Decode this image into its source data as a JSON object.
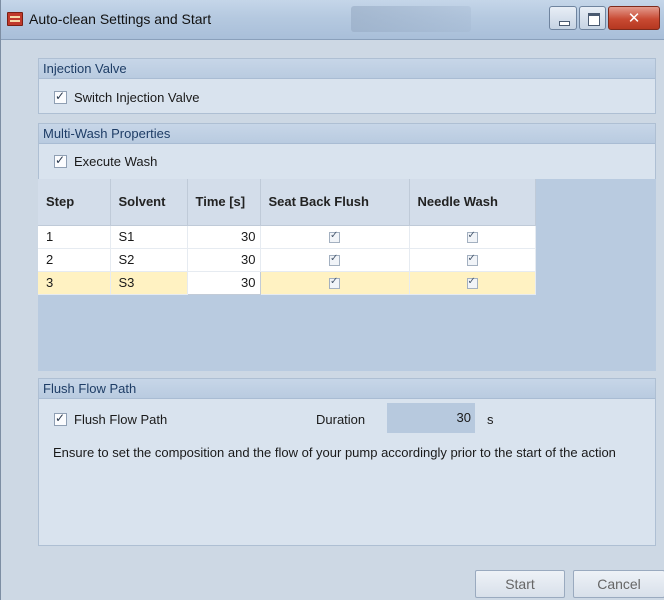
{
  "window": {
    "title": "Auto-clean Settings and Start"
  },
  "injection_valve": {
    "header": "Injection Valve",
    "switch_label": "Switch Injection Valve",
    "switch_checked": true
  },
  "multi_wash": {
    "header": "Multi-Wash Properties",
    "execute_label": "Execute Wash",
    "execute_checked": true,
    "columns": [
      "Step",
      "Solvent",
      "Time [s]",
      "Seat Back Flush",
      "Needle Wash"
    ],
    "rows": [
      {
        "step": "1",
        "solvent": "S1",
        "time": "30",
        "seat_back_flush": true,
        "needle_wash": true
      },
      {
        "step": "2",
        "solvent": "S2",
        "time": "30",
        "seat_back_flush": true,
        "needle_wash": true
      },
      {
        "step": "3",
        "solvent": "S3",
        "time": "30",
        "seat_back_flush": true,
        "needle_wash": true
      }
    ],
    "selected_row": 2
  },
  "flush": {
    "header": "Flush Flow Path",
    "flush_label": "Flush Flow Path",
    "flush_checked": true,
    "duration_label": "Duration",
    "duration_value": "30",
    "duration_unit": "s",
    "info": "Ensure to set the composition and the flow of your pump accordingly prior to the start of the action"
  },
  "footer": {
    "start_label": "Start",
    "cancel_label": "Cancel"
  }
}
